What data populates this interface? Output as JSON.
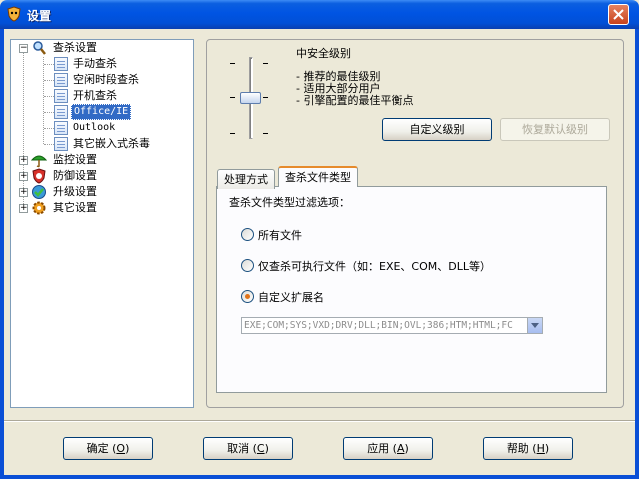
{
  "window": {
    "title": "设置"
  },
  "tree": {
    "root": {
      "label": "查杀设置"
    },
    "children": [
      {
        "label": "手动查杀"
      },
      {
        "label": "空闲时段查杀"
      },
      {
        "label": "开机查杀"
      },
      {
        "label": "Office/IE",
        "selected": true
      },
      {
        "label": "Outlook"
      },
      {
        "label": "其它嵌入式杀毒"
      }
    ],
    "others": [
      {
        "label": "监控设置"
      },
      {
        "label": "防御设置"
      },
      {
        "label": "升级设置"
      },
      {
        "label": "其它设置"
      }
    ]
  },
  "security": {
    "level_title": "中安全级别",
    "slider_level_fraction": 0.5,
    "bullets": [
      "- 推荐的最佳级别",
      "- 适用大部分用户",
      "- 引擎配置的最佳平衡点"
    ],
    "custom_button": "自定义级别",
    "restore_button": "恢复默认级别"
  },
  "tabs": [
    {
      "label": "处理方式",
      "active": false
    },
    {
      "label": "查杀文件类型",
      "active": true
    }
  ],
  "filter": {
    "heading": "查杀文件类型过滤选项：",
    "options": [
      {
        "label": "所有文件",
        "checked": false
      },
      {
        "label": "仅查杀可执行文件（如：EXE、COM、DLL等）",
        "checked": false
      },
      {
        "label": "自定义扩展名",
        "checked": true
      }
    ],
    "extensions_value": "EXE;COM;SYS;VXD;DRV;DLL;BIN;OVL;386;HTM;HTML;FC"
  },
  "footer": {
    "ok": {
      "text": "确定 (",
      "key": "O",
      "tail": ")"
    },
    "cancel": {
      "text": "取消 (",
      "key": "C",
      "tail": ")"
    },
    "apply": {
      "text": "应用 (",
      "key": "A",
      "tail": ")"
    },
    "help": {
      "text": "帮助 (",
      "key": "H",
      "tail": ")"
    }
  },
  "colors": {
    "titlebar": "#0054e3",
    "selection": "#316ac5",
    "tab_accent": "#e68b2c",
    "radio_dot": "#e0731a"
  }
}
